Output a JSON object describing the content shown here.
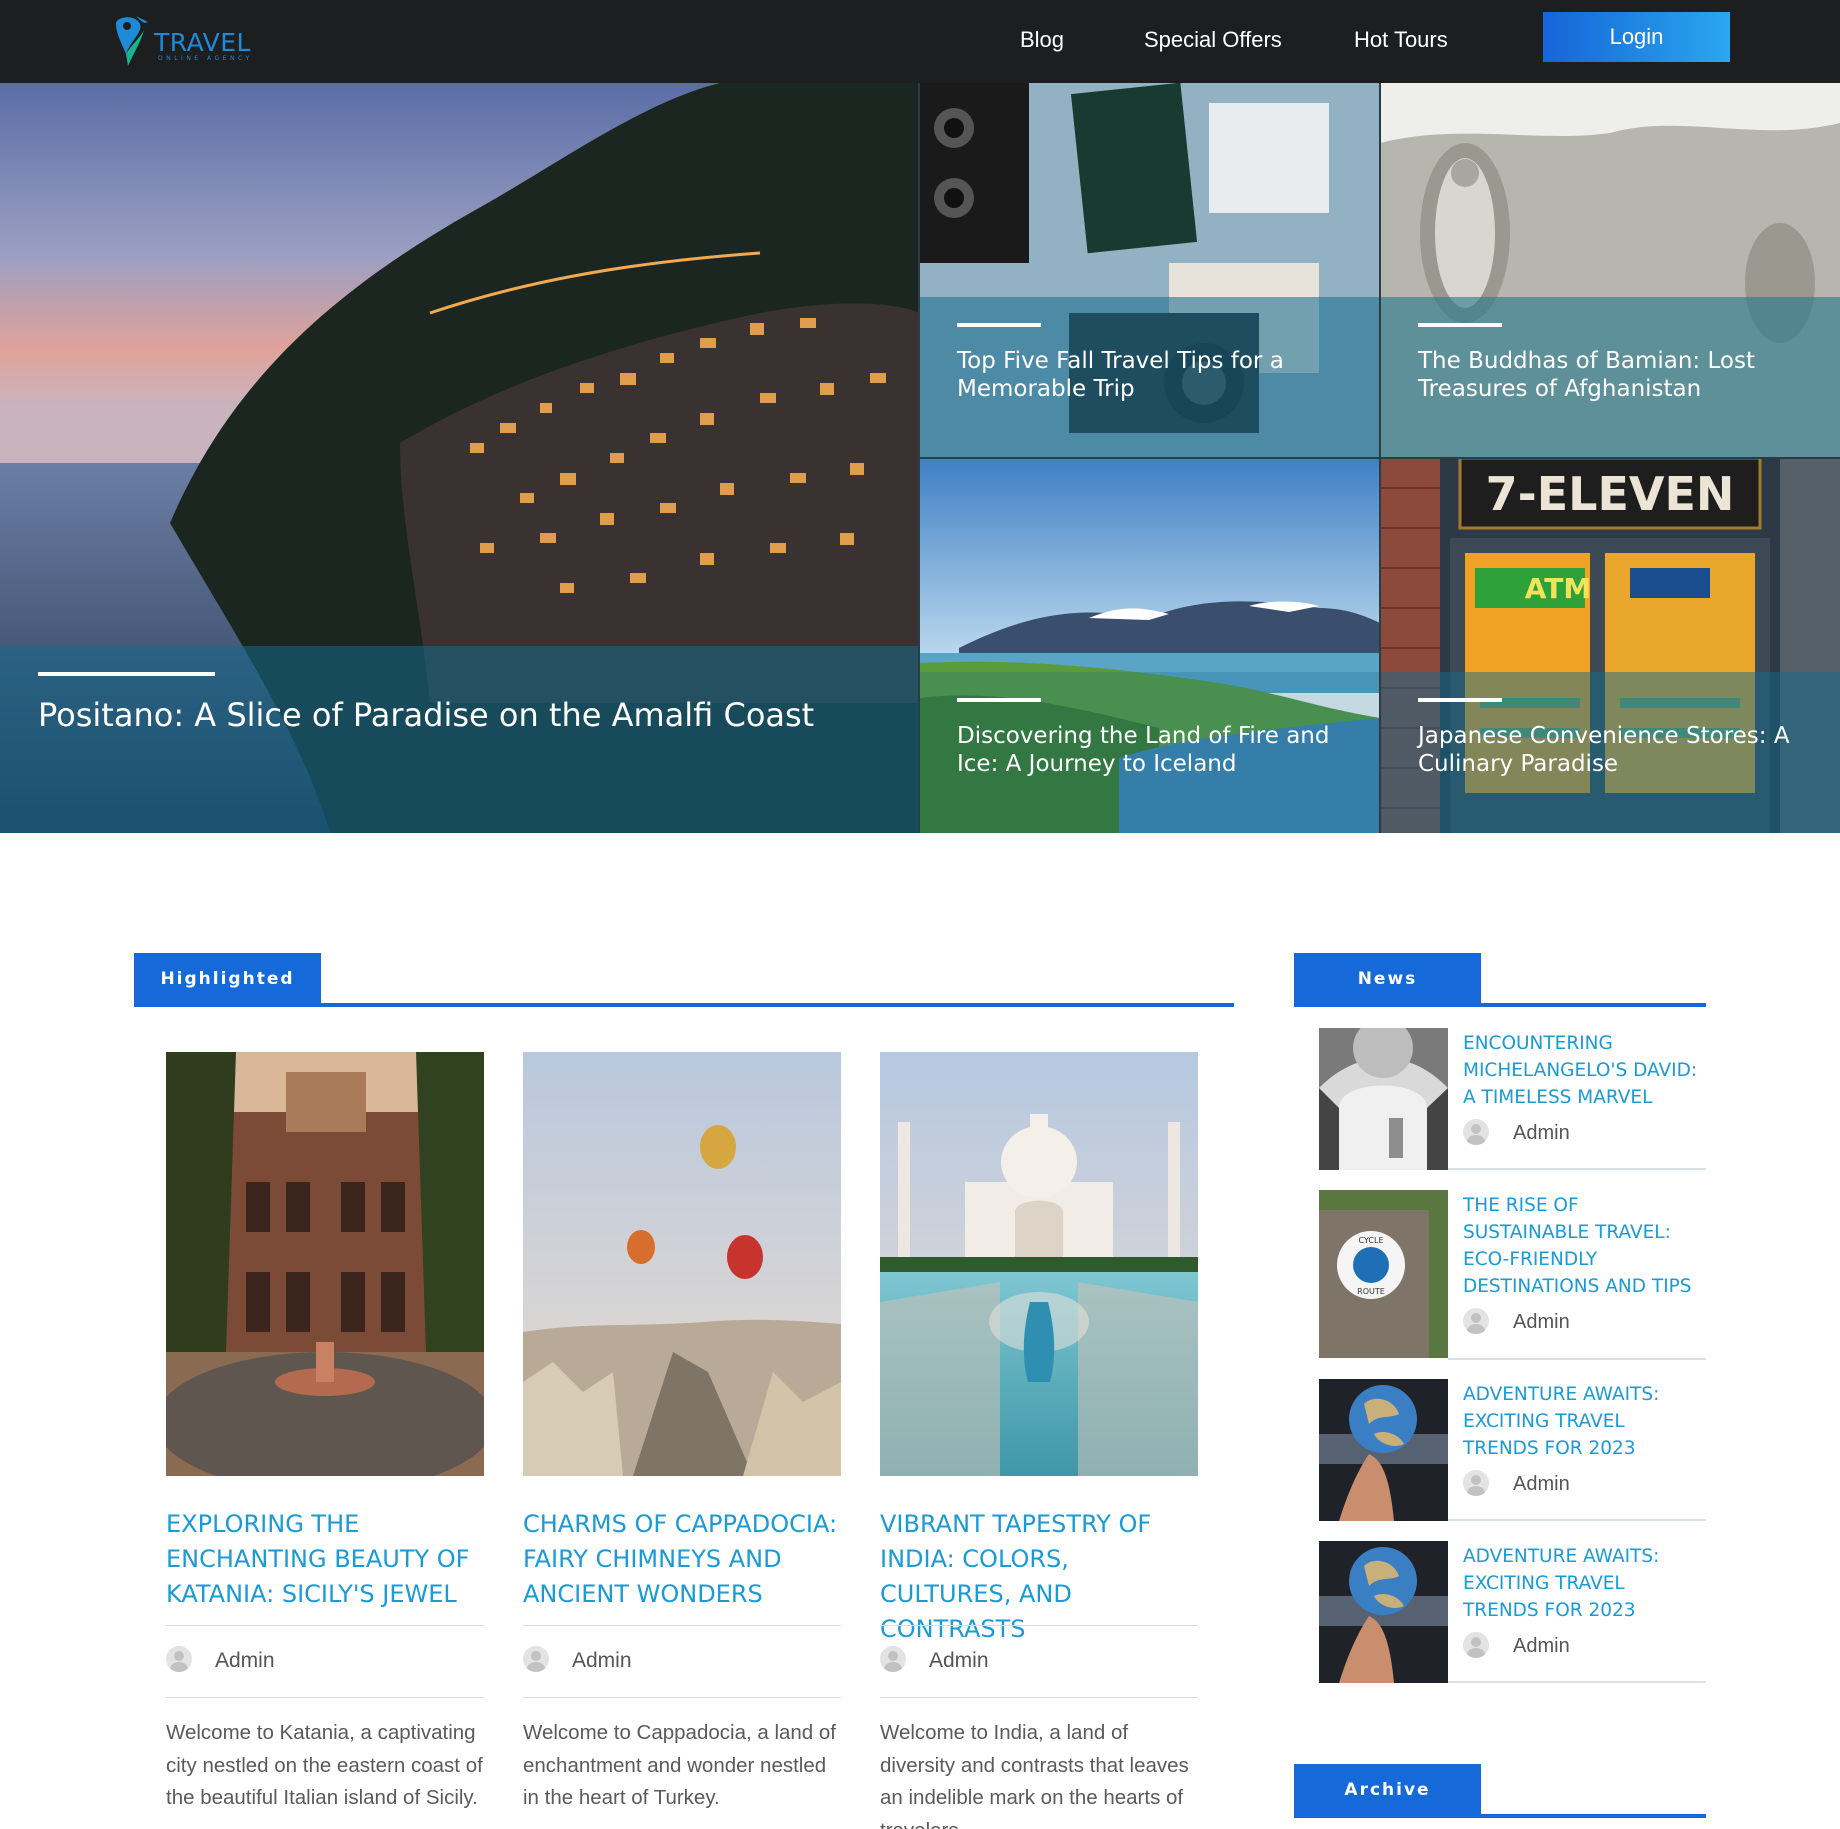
{
  "brand": {
    "name": "TRAVEL",
    "tagline": "ONLINE AGENCY",
    "accent": "#1669d9",
    "link_color": "#1a9ad6",
    "header_bg": "#1d1e20"
  },
  "nav": {
    "links": [
      "Blog",
      "Special Offers",
      "Hot Tours"
    ],
    "login_label": "Login"
  },
  "hero": {
    "main": {
      "title": "Positano: A Slice of Paradise on the Amalfi Coast"
    },
    "tiles": [
      {
        "title": "Top Five Fall Travel Tips for a Memorable Trip"
      },
      {
        "title": "The Buddhas of Bamian: Lost Treasures of Afghanistan"
      },
      {
        "title": "Discovering the Land of Fire and Ice: A Journey to Iceland"
      },
      {
        "title": "Japanese Convenience Stores: A Culinary Paradise"
      }
    ],
    "store_sign": "7-ELEVEN",
    "atm_sign": "ATM"
  },
  "highlighted": {
    "label": "Highlighted",
    "cards": [
      {
        "title": "Exploring the Enchanting Beauty of Katania: Sicily's Jewel",
        "author": "Admin",
        "excerpt": "Welcome to Katania, a captivating city nestled on the eastern coast of the beautiful Italian island of Sicily."
      },
      {
        "title": "Charms of Cappadocia: Fairy Chimneys and Ancient Wonders",
        "author": "Admin",
        "excerpt": "Welcome to Cappadocia, a land of enchantment and wonder nestled in the heart of Turkey."
      },
      {
        "title": "Vibrant Tapestry of India: Colors, Cultures, and Contrasts",
        "author": "Admin",
        "excerpt": "Welcome to India, a land of diversity and contrasts that leaves an indelible mark on the hearts of travelers."
      }
    ]
  },
  "news": {
    "label": "News",
    "items": [
      {
        "title": "Encountering Michelangelo's David: A Timeless Marvel",
        "author": "Admin"
      },
      {
        "title": "The Rise of Sustainable Travel: Eco-Friendly Destinations and Tips",
        "author": "Admin",
        "sign_top": "CYCLE",
        "sign_bottom": "ROUTE"
      },
      {
        "title": "Adventure Awaits: Exciting Travel Trends for 2023",
        "author": "Admin"
      },
      {
        "title": "Adventure Awaits: Exciting Travel Trends for 2023",
        "author": "Admin"
      }
    ]
  },
  "archive": {
    "label": "Archive"
  }
}
